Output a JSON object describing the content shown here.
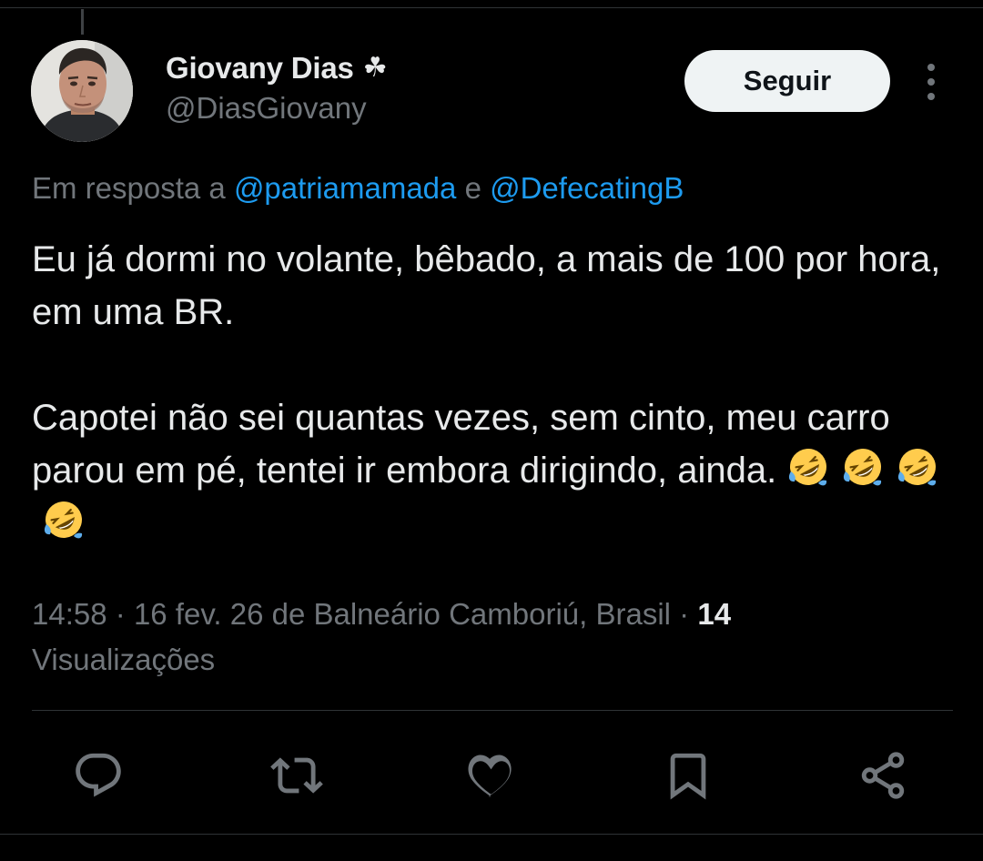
{
  "author": {
    "display_name": "Giovany Dias",
    "badge_glyph": "☘",
    "handle": "@DiasGiovany"
  },
  "follow_label": "Seguir",
  "reply_context": {
    "prefix": "Em resposta a",
    "mentions": [
      "@patriamamada",
      "@DefecatingB"
    ],
    "conjunction": "e"
  },
  "tweet": {
    "paragraph1": "Eu já dormi no volante, bêbado, a mais de 100 por hora, em uma BR.",
    "paragraph2": "Capotei não sei quantas vezes, sem cinto, meu carro parou em pé, tentei ir embora dirigindo, ainda.",
    "emoji": "rolling-on-the-floor-laughing",
    "emoji_count": 4
  },
  "meta": {
    "time": "14:58",
    "date": "16 fev. 26",
    "location": "de Balneário Camboriú, Brasil",
    "separator": "·",
    "views_count": "14",
    "views_label": "Visualizações"
  },
  "actions": [
    "reply-icon",
    "retweet-icon",
    "like-icon",
    "bookmark-icon",
    "share-icon"
  ],
  "colors": {
    "background": "#000000",
    "text": "#e7e9ea",
    "secondary": "#71767b",
    "link": "#1d9bf0",
    "divider": "#2f3336",
    "button_bg": "#eff3f4"
  }
}
